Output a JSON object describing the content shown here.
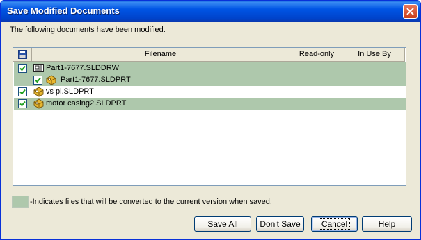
{
  "window": {
    "title": "Save Modified Documents"
  },
  "description": "The following documents have been modified.",
  "table": {
    "columns": [
      "Filename",
      "Read-only",
      "In Use By"
    ],
    "rows": [
      {
        "name": "Part1-7677.SLDDRW",
        "checked": true,
        "icon": "drawing-icon",
        "highlight": true,
        "indent": 0
      },
      {
        "name": "Part1-7677.SLDPRT",
        "checked": true,
        "icon": "part-icon",
        "highlight": true,
        "indent": 1
      },
      {
        "name": "vs pl.SLDPRT",
        "checked": true,
        "icon": "part-icon",
        "highlight": false,
        "indent": 0
      },
      {
        "name": "motor casing2.SLDPRT",
        "checked": true,
        "icon": "part-icon",
        "highlight": true,
        "indent": 0
      }
    ]
  },
  "legend": {
    "text": "-Indicates files that will be converted to the current version when saved.",
    "color": "#aec8ac"
  },
  "buttons": {
    "save_all": "Save All",
    "dont_save": "Don't Save",
    "cancel": "Cancel",
    "help": "Help"
  }
}
